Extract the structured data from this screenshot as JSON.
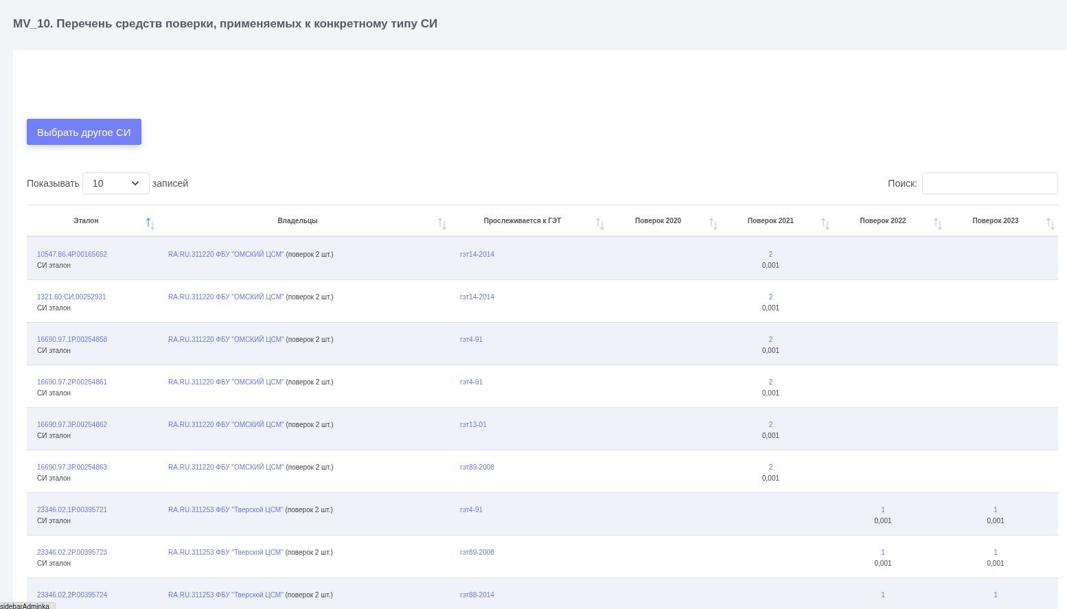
{
  "page_title": "MV_10. Перечень средств поверки, применяемых к конкретному типу СИ",
  "choose_button": "Выбрать другое СИ",
  "length_control": {
    "label_before": "Показывать",
    "value": "10",
    "label_after": "записей"
  },
  "search": {
    "label": "Поиск:"
  },
  "table": {
    "columns": [
      {
        "label": "Эталон",
        "sorted": true
      },
      {
        "label": "Владельцы",
        "sorted": false
      },
      {
        "label": "Прослеживается к ГЭТ",
        "sorted": false
      },
      {
        "label": "Поверок 2020",
        "sorted": false
      },
      {
        "label": "Поверок 2021",
        "sorted": false
      },
      {
        "label": "Поверок 2022",
        "sorted": false
      },
      {
        "label": "Поверок 2023",
        "sorted": false
      }
    ],
    "rows": [
      {
        "etalon": "10547.86.4Р.00165652",
        "etalon_type": "СИ эталон",
        "owner": "RA.RU.311220 ФБУ \"ОМСКИЙ ЦСМ\"",
        "owner_note": "(поверок 2 шт.)",
        "get": "гэт14-2014",
        "y2021": {
          "count": "2",
          "value": "0,001"
        }
      },
      {
        "etalon": "1321.60.СИ.00252931",
        "etalon_type": "СИ эталон",
        "owner": "RA.RU.311220 ФБУ \"ОМСКИЙ ЦСМ\"",
        "owner_note": "(поверок 2 шт.)",
        "get": "гэт14-2014",
        "y2021": {
          "count": "2",
          "value": "0,001"
        }
      },
      {
        "etalon": "16690.97.1Р.00254858",
        "etalon_type": "СИ эталон",
        "owner": "RA.RU.311220 ФБУ \"ОМСКИЙ ЦСМ\"",
        "owner_note": "(поверок 2 шт.)",
        "get": "гэт4-91",
        "y2021": {
          "count": "2",
          "value": "0,001"
        }
      },
      {
        "etalon": "16690.97.2Р.00254861",
        "etalon_type": "СИ эталон",
        "owner": "RA.RU.311220 ФБУ \"ОМСКИЙ ЦСМ\"",
        "owner_note": "(поверок 2 шт.)",
        "get": "гэт4-91",
        "y2021": {
          "count": "2",
          "value": "0,001"
        }
      },
      {
        "etalon": "16690.97.3Р.00254862",
        "etalon_type": "СИ эталон",
        "owner": "RA.RU.311220 ФБУ \"ОМСКИЙ ЦСМ\"",
        "owner_note": "(поверок 2 шт.)",
        "get": "гэт13-01",
        "y2021": {
          "count": "2",
          "value": "0,001"
        }
      },
      {
        "etalon": "16690.97.3Р.00254863",
        "etalon_type": "СИ эталон",
        "owner": "RA.RU.311220 ФБУ \"ОМСКИЙ ЦСМ\"",
        "owner_note": "(поверок 2 шт.)",
        "get": "гэт89-2008",
        "y2021": {
          "count": "2",
          "value": "0,001"
        }
      },
      {
        "etalon": "23346.02.1Р.00395721",
        "etalon_type": "СИ эталон",
        "owner": "RA.RU.311253 ФБУ \"Тверской ЦСМ\"",
        "owner_note": "(поверок 2 шт.)",
        "get": "гэт4-91",
        "y2022": {
          "count": "1",
          "value": "0,001"
        },
        "y2023": {
          "count": "1",
          "value": "0,001"
        }
      },
      {
        "etalon": "23346.02.2Р.00395723",
        "etalon_type": "СИ эталон",
        "owner": "RA.RU.311253 ФБУ \"Тверской ЦСМ\"",
        "owner_note": "(поверок 2 шт.)",
        "get": "гэт89-2008",
        "y2022": {
          "count": "1",
          "value": "0,001"
        },
        "y2023": {
          "count": "1",
          "value": "0,001"
        }
      },
      {
        "etalon": "23346.02.2Р.00395724",
        "owner": "RA.RU.311253 ФБУ \"Тверской ЦСМ\"",
        "owner_note": "(поверок 2 шт.)",
        "get": "гэт88-2014",
        "y2022": {
          "count": "1"
        },
        "y2023": {
          "count": "1"
        }
      }
    ]
  },
  "status_link": "sidebarAdminka"
}
